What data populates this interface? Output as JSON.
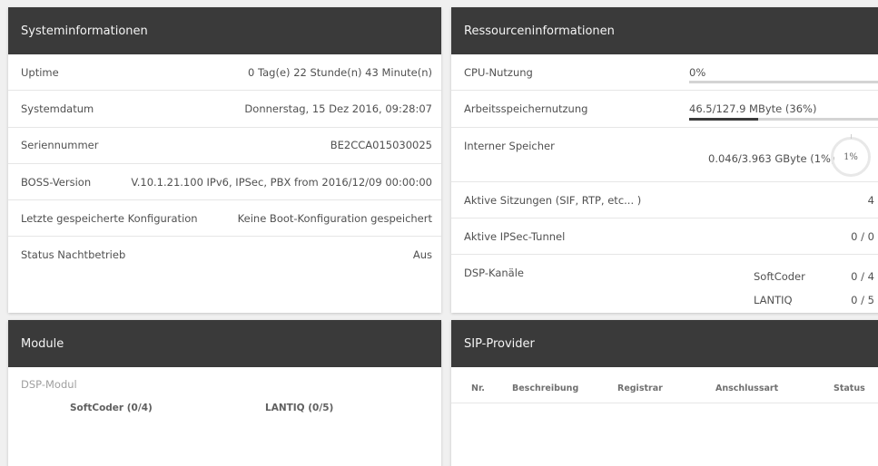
{
  "system": {
    "title": "Systeminformationen",
    "rows": [
      {
        "label": "Uptime",
        "value": "0 Tag(e) 22 Stunde(n) 43 Minute(n)"
      },
      {
        "label": "Systemdatum",
        "value": "Donnerstag, 15 Dez 2016, 09:28:07"
      },
      {
        "label": "Seriennummer",
        "value": "BE2CCA015030025"
      },
      {
        "label": "BOSS-Version",
        "value": "V.10.1.21.100 IPv6, IPSec, PBX from 2016/12/09 00:00:00"
      },
      {
        "label": "Letzte gespeicherte Konfiguration",
        "value": "Keine Boot-Konfiguration gespeichert"
      },
      {
        "label": "Status Nachtbetrieb",
        "value": "Aus"
      }
    ]
  },
  "resources": {
    "title": "Ressourceninformationen",
    "cpu": {
      "label": "CPU-Nutzung",
      "value": "0%",
      "fraction": 0.0
    },
    "ram": {
      "label": "Arbeitsspeichernutzung",
      "value": "46.5/127.9 MByte (36%)",
      "fraction": 0.36
    },
    "storage": {
      "label": "Interner Speicher",
      "value": "0.046/3.963 GByte (1%)",
      "ring_text": "1%",
      "fraction": 0.01
    },
    "sessions": {
      "label": "Aktive Sitzungen (SIF, RTP, etc... )",
      "value": "4"
    },
    "ipsec": {
      "label": "Aktive IPSec-Tunnel",
      "value": "0 / 0"
    },
    "dsp": {
      "label": "DSP-Kanäle",
      "items": [
        {
          "name": "SoftCoder",
          "value": "0 / 4"
        },
        {
          "name": "LANTIQ",
          "value": "0 / 5"
        }
      ]
    }
  },
  "modules": {
    "title": "Module",
    "dsp_label": "DSP-Modul",
    "items": [
      "SoftCoder (0/4)",
      "LANTIQ (0/5)"
    ]
  },
  "sip": {
    "title": "SIP-Provider",
    "columns": [
      "Nr.",
      "Beschreibung",
      "Registrar",
      "Anschlussart",
      "Status"
    ]
  }
}
